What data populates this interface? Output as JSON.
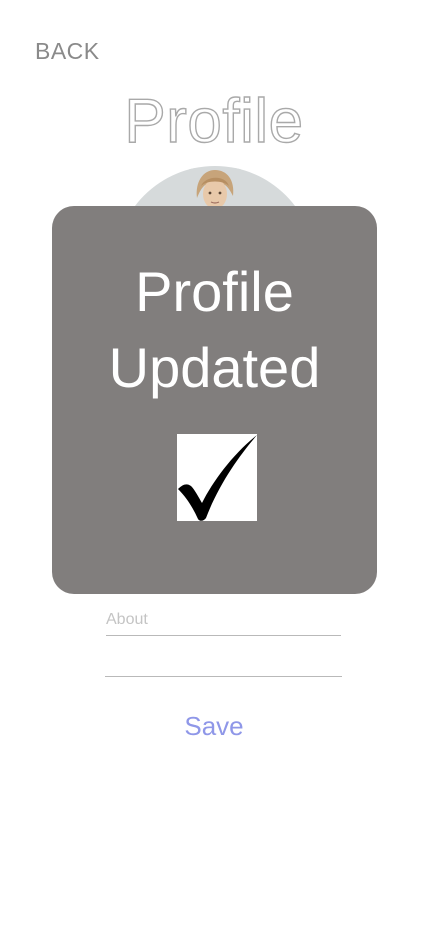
{
  "header": {
    "back_label": "BACK",
    "title": "Profile"
  },
  "form": {
    "about_placeholder": "About",
    "save_label": "Save"
  },
  "modal": {
    "title_line1": "Profile",
    "title_line2": "Updated",
    "icon": "checkmark-icon"
  },
  "colors": {
    "modal_background": "#817e7d",
    "save_link": "#8f97e8",
    "back_text": "#8a8a8a"
  }
}
